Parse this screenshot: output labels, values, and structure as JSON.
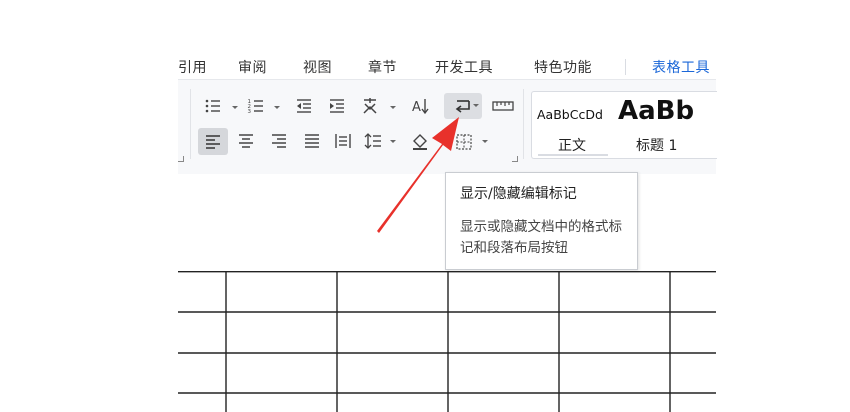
{
  "menu": {
    "tabs": [
      {
        "label": "引用",
        "active": false
      },
      {
        "label": "审阅",
        "active": false
      },
      {
        "label": "视图",
        "active": false
      },
      {
        "label": "章节",
        "active": false
      },
      {
        "label": "开发工具",
        "active": false
      },
      {
        "label": "特色功能",
        "active": false
      },
      {
        "label": "表格工具",
        "active": true
      }
    ]
  },
  "paragraph_toolbar": {
    "row1": [
      "bullet-list-icon",
      "numbered-list-icon",
      "decrease-indent-icon",
      "increase-indent-icon",
      "chinese-layout-icon",
      "sort-icon",
      "show-hide-marks-icon",
      "ruler-icon"
    ],
    "row2": [
      "align-left-icon",
      "align-center-icon",
      "align-right-icon",
      "justify-icon",
      "distributed-align-icon",
      "line-spacing-icon",
      "shading-icon",
      "borders-icon"
    ],
    "active_button": "align-left-icon",
    "highlighted_button": "show-hide-marks-icon"
  },
  "styles": {
    "items": [
      {
        "sample": "AaBbCcDd",
        "name": "正文"
      },
      {
        "sample": "AaBb",
        "name": "标题 1"
      }
    ]
  },
  "tooltip": {
    "title": "显示/隐藏编辑标记",
    "body": "显示或隐藏文档中的格式标记和段落布局按钮"
  },
  "annotation": {
    "arrow_color": "#e8312b"
  },
  "colors": {
    "accent": "#1b67d8",
    "ribbon_bg": "#f7f8fa",
    "active_button_bg": "#d5d7db",
    "table_border": "#222222"
  }
}
